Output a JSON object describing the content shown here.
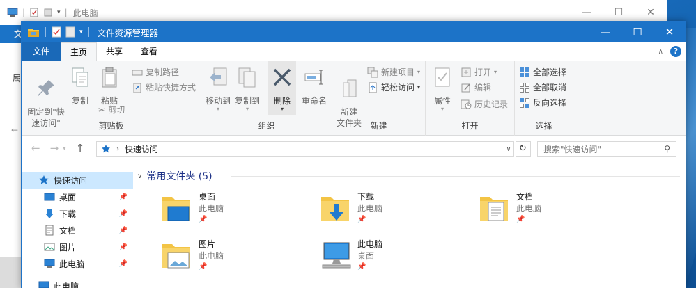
{
  "background_window": {
    "title": "此电脑",
    "tab_label": "文",
    "side_char": "属"
  },
  "window": {
    "title": "文件资源管理器",
    "controls": {
      "minimize": "—",
      "maximize": "☐",
      "close": "✕"
    }
  },
  "tabs": {
    "file": "文件",
    "home": "主页",
    "share": "共享",
    "view": "查看"
  },
  "ribbon": {
    "clipboard": {
      "label": "剪贴板",
      "pin_quick": "固定到\"快\n速访问\"",
      "copy": "复制",
      "paste": "粘贴",
      "copy_path": "复制路径",
      "paste_shortcut": "粘贴快捷方式",
      "cut": "剪切"
    },
    "organize": {
      "label": "组织",
      "move_to": "移动到",
      "copy_to": "复制到",
      "delete": "删除",
      "rename": "重命名"
    },
    "new": {
      "label": "新建",
      "new_folder": "新建\n文件夹",
      "new_item": "新建项目",
      "easy_access": "轻松访问"
    },
    "open": {
      "label": "打开",
      "properties": "属性",
      "open": "打开",
      "edit": "编辑",
      "history": "历史记录"
    },
    "select": {
      "label": "选择",
      "select_all": "全部选择",
      "select_none": "全部取消",
      "invert": "反向选择"
    }
  },
  "address": {
    "path": "快速访问",
    "search_placeholder": "搜索\"快速访问\""
  },
  "nav_pane": {
    "items": [
      {
        "label": "快速访问",
        "selected": true
      },
      {
        "label": "桌面",
        "pinned": true
      },
      {
        "label": "下载",
        "pinned": true
      },
      {
        "label": "文档",
        "pinned": true
      },
      {
        "label": "图片",
        "pinned": true
      },
      {
        "label": "此电脑",
        "pinned": true
      },
      {
        "label": "此电脑"
      }
    ]
  },
  "content": {
    "section_title": "常用文件夹 (5)",
    "folders": [
      {
        "name": "桌面",
        "location": "此电脑"
      },
      {
        "name": "下载",
        "location": "此电脑"
      },
      {
        "name": "文档",
        "location": "此电脑"
      },
      {
        "name": "图片",
        "location": "此电脑"
      },
      {
        "name": "此电脑",
        "location": "桌面"
      }
    ]
  },
  "colors": {
    "title_blue": "#1c73c8",
    "selection": "#cce8ff",
    "section_text": "#1e3287"
  }
}
